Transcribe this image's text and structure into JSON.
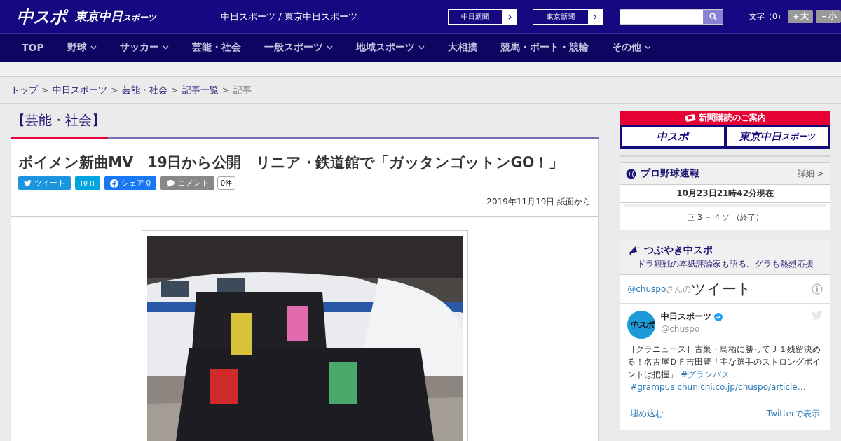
{
  "header": {
    "logo_main": "中スポ",
    "logo_tokyo": "東京中日",
    "logo_tokyo_small": "スポーツ",
    "site_title": "中日スポーツ / 東京中日スポーツ",
    "partner_links": [
      {
        "label": "中日新聞",
        "arrow": "›"
      },
      {
        "label": "東京新聞",
        "arrow": "›"
      }
    ],
    "font_size_label": "文字（0）",
    "font_buttons": [
      "＋大",
      "－小"
    ]
  },
  "nav": [
    {
      "label": "TOP",
      "dropdown": false
    },
    {
      "label": "野球",
      "dropdown": true
    },
    {
      "label": "サッカー",
      "dropdown": true
    },
    {
      "label": "芸能・社会",
      "dropdown": false
    },
    {
      "label": "一般スポーツ",
      "dropdown": true
    },
    {
      "label": "地域スポーツ",
      "dropdown": true
    },
    {
      "label": "大相撲",
      "dropdown": false
    },
    {
      "label": "競馬・ボート・競輪",
      "dropdown": false
    },
    {
      "label": "その他",
      "dropdown": true
    }
  ],
  "breadcrumb": [
    {
      "label": "トップ",
      "link": true
    },
    {
      "label": "中日スポーツ",
      "link": true
    },
    {
      "label": "芸能・社会",
      "link": true
    },
    {
      "label": "記事一覧",
      "link": true
    },
    {
      "label": "記事",
      "link": false
    }
  ],
  "breadcrumb_separator": ">",
  "section_title": "【芸能・社会】",
  "article": {
    "headline": "ボイメン新曲MV　19日から公開　リニア・鉄道館で「ガッタンゴットンGO！」",
    "share": [
      {
        "kind": "twitter",
        "label": "ツイート"
      },
      {
        "kind": "hatena",
        "label": "B!",
        "count": "0"
      },
      {
        "kind": "facebook",
        "label": "シェア",
        "count": "0"
      },
      {
        "kind": "comment",
        "label": "コメント",
        "count": "0件"
      }
    ],
    "date": "2019年11月19日 紙面から"
  },
  "sidebar": {
    "subscribe": {
      "title": "新聞購読のご案内",
      "logos": [
        "中スポ",
        "東京中日"
      ],
      "logo_small": "スポーツ"
    },
    "baseball": {
      "title": "プロ野球速報",
      "detail": "詳細 >",
      "time": "10月23日21時42分現在",
      "score": "巨 3 － 4 ソ （終了）"
    },
    "tweets": {
      "title": "つぶやき中スポ",
      "subtitle": "ドラ観戦の本紙評論家も語る。グラも熱烈応援",
      "handle": "@chuspo",
      "handle_suffix": "さんの",
      "heading": "ツイート",
      "avatar_text": "中スポ",
      "name": "中日スポーツ",
      "verified": true,
      "screen_name": "@chuspo",
      "body": [
        {
          "kind": "text",
          "text": "［グラニュース］古巣・鳥栖に勝ってＪ１残留決める！名古屋ＤＦ吉田豊「主な選手のストロングポイントは把握」"
        },
        {
          "kind": "link",
          "text": "#グランパス"
        },
        {
          "kind": "link",
          "text": "#grampus"
        },
        {
          "kind": "link",
          "text": "chunichi.co.jp/chuspo/article…"
        }
      ],
      "embed": "埋め込む",
      "view": "Twitterで表示"
    }
  }
}
